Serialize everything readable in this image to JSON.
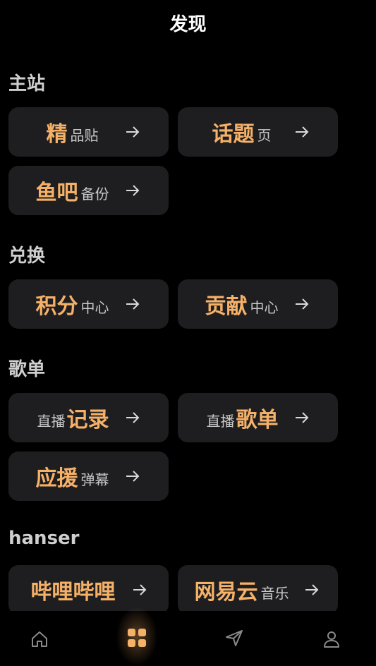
{
  "header": {
    "title": "发现"
  },
  "colors": {
    "accent": "#f6b168",
    "card": "#1e1e20",
    "background": "#000000"
  },
  "sections": [
    {
      "title": "主站",
      "cards": [
        {
          "main": "精",
          "sub": "品贴"
        },
        {
          "main": "话题",
          "sub": "页"
        },
        {
          "main": "鱼吧",
          "sub": "备份"
        }
      ]
    },
    {
      "title": "兑换",
      "cards": [
        {
          "main": "积分",
          "sub": "中心"
        },
        {
          "main": "贡献",
          "sub": "中心"
        }
      ]
    },
    {
      "title": "歌单",
      "cards": [
        {
          "pre": "直播",
          "main": "记录"
        },
        {
          "pre": "直播",
          "main": "歌单"
        },
        {
          "main": "应援",
          "sub": "弹幕"
        }
      ]
    },
    {
      "title": "hanser",
      "cards": [
        {
          "main": "哔哩哔哩"
        },
        {
          "main": "网易云",
          "sub": "音乐"
        }
      ]
    }
  ],
  "tabbar": {
    "items": [
      {
        "icon": "home-icon",
        "active": false
      },
      {
        "icon": "grid-icon",
        "active": true
      },
      {
        "icon": "send-icon",
        "active": false
      },
      {
        "icon": "user-icon",
        "active": false
      }
    ]
  }
}
